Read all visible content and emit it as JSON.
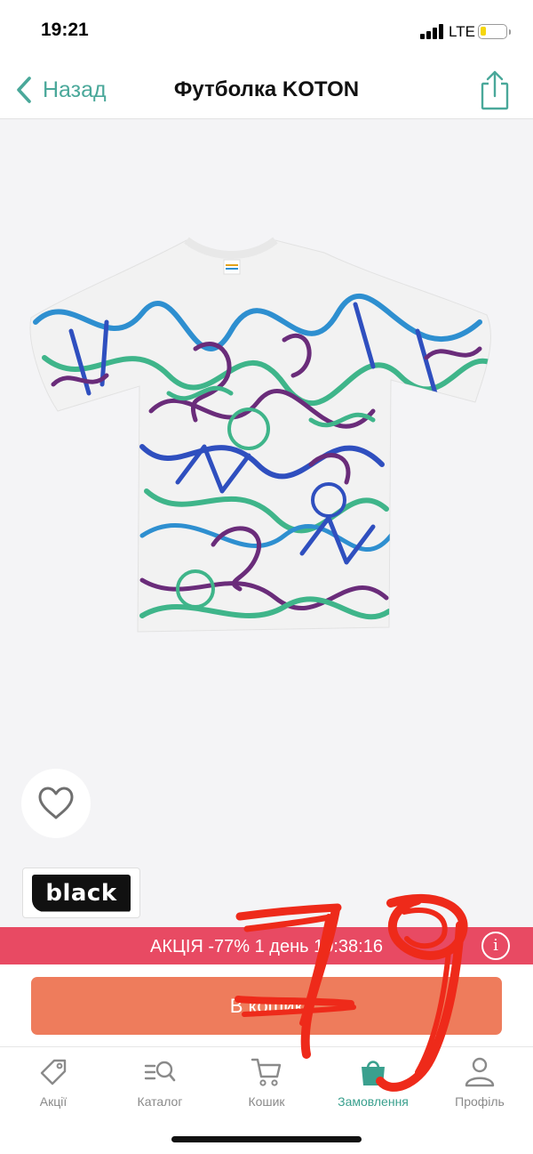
{
  "status_bar": {
    "time": "19:21",
    "network": "LTE",
    "battery_level": 0.2
  },
  "nav": {
    "back_label": "Назад",
    "title": "Футболка KOTON",
    "share_icon": "share-icon"
  },
  "product": {
    "image_alt": "Графіті футболка",
    "brand_logo": "black",
    "favorite_icon": "heart-icon"
  },
  "promo": {
    "text": "АКЦІЯ -77%  1 день 10:38:16",
    "info_icon": "info-icon",
    "bg_color": "#e84a63"
  },
  "buy_button": {
    "label": "В кошик",
    "color": "#ee7c5c"
  },
  "tabs": [
    {
      "label": "Акції",
      "icon": "tag-icon",
      "active": false
    },
    {
      "label": "Каталог",
      "icon": "catalog-search-icon",
      "active": false
    },
    {
      "label": "Кошик",
      "icon": "cart-icon",
      "active": false
    },
    {
      "label": "Замовлення",
      "icon": "shopping-bag-icon",
      "active": true
    },
    {
      "label": "Профіль",
      "icon": "profile-icon",
      "active": false
    }
  ],
  "annotation": {
    "handwritten_text": "79",
    "color": "#ee2a1a"
  },
  "accent_color": "#4aa89a"
}
